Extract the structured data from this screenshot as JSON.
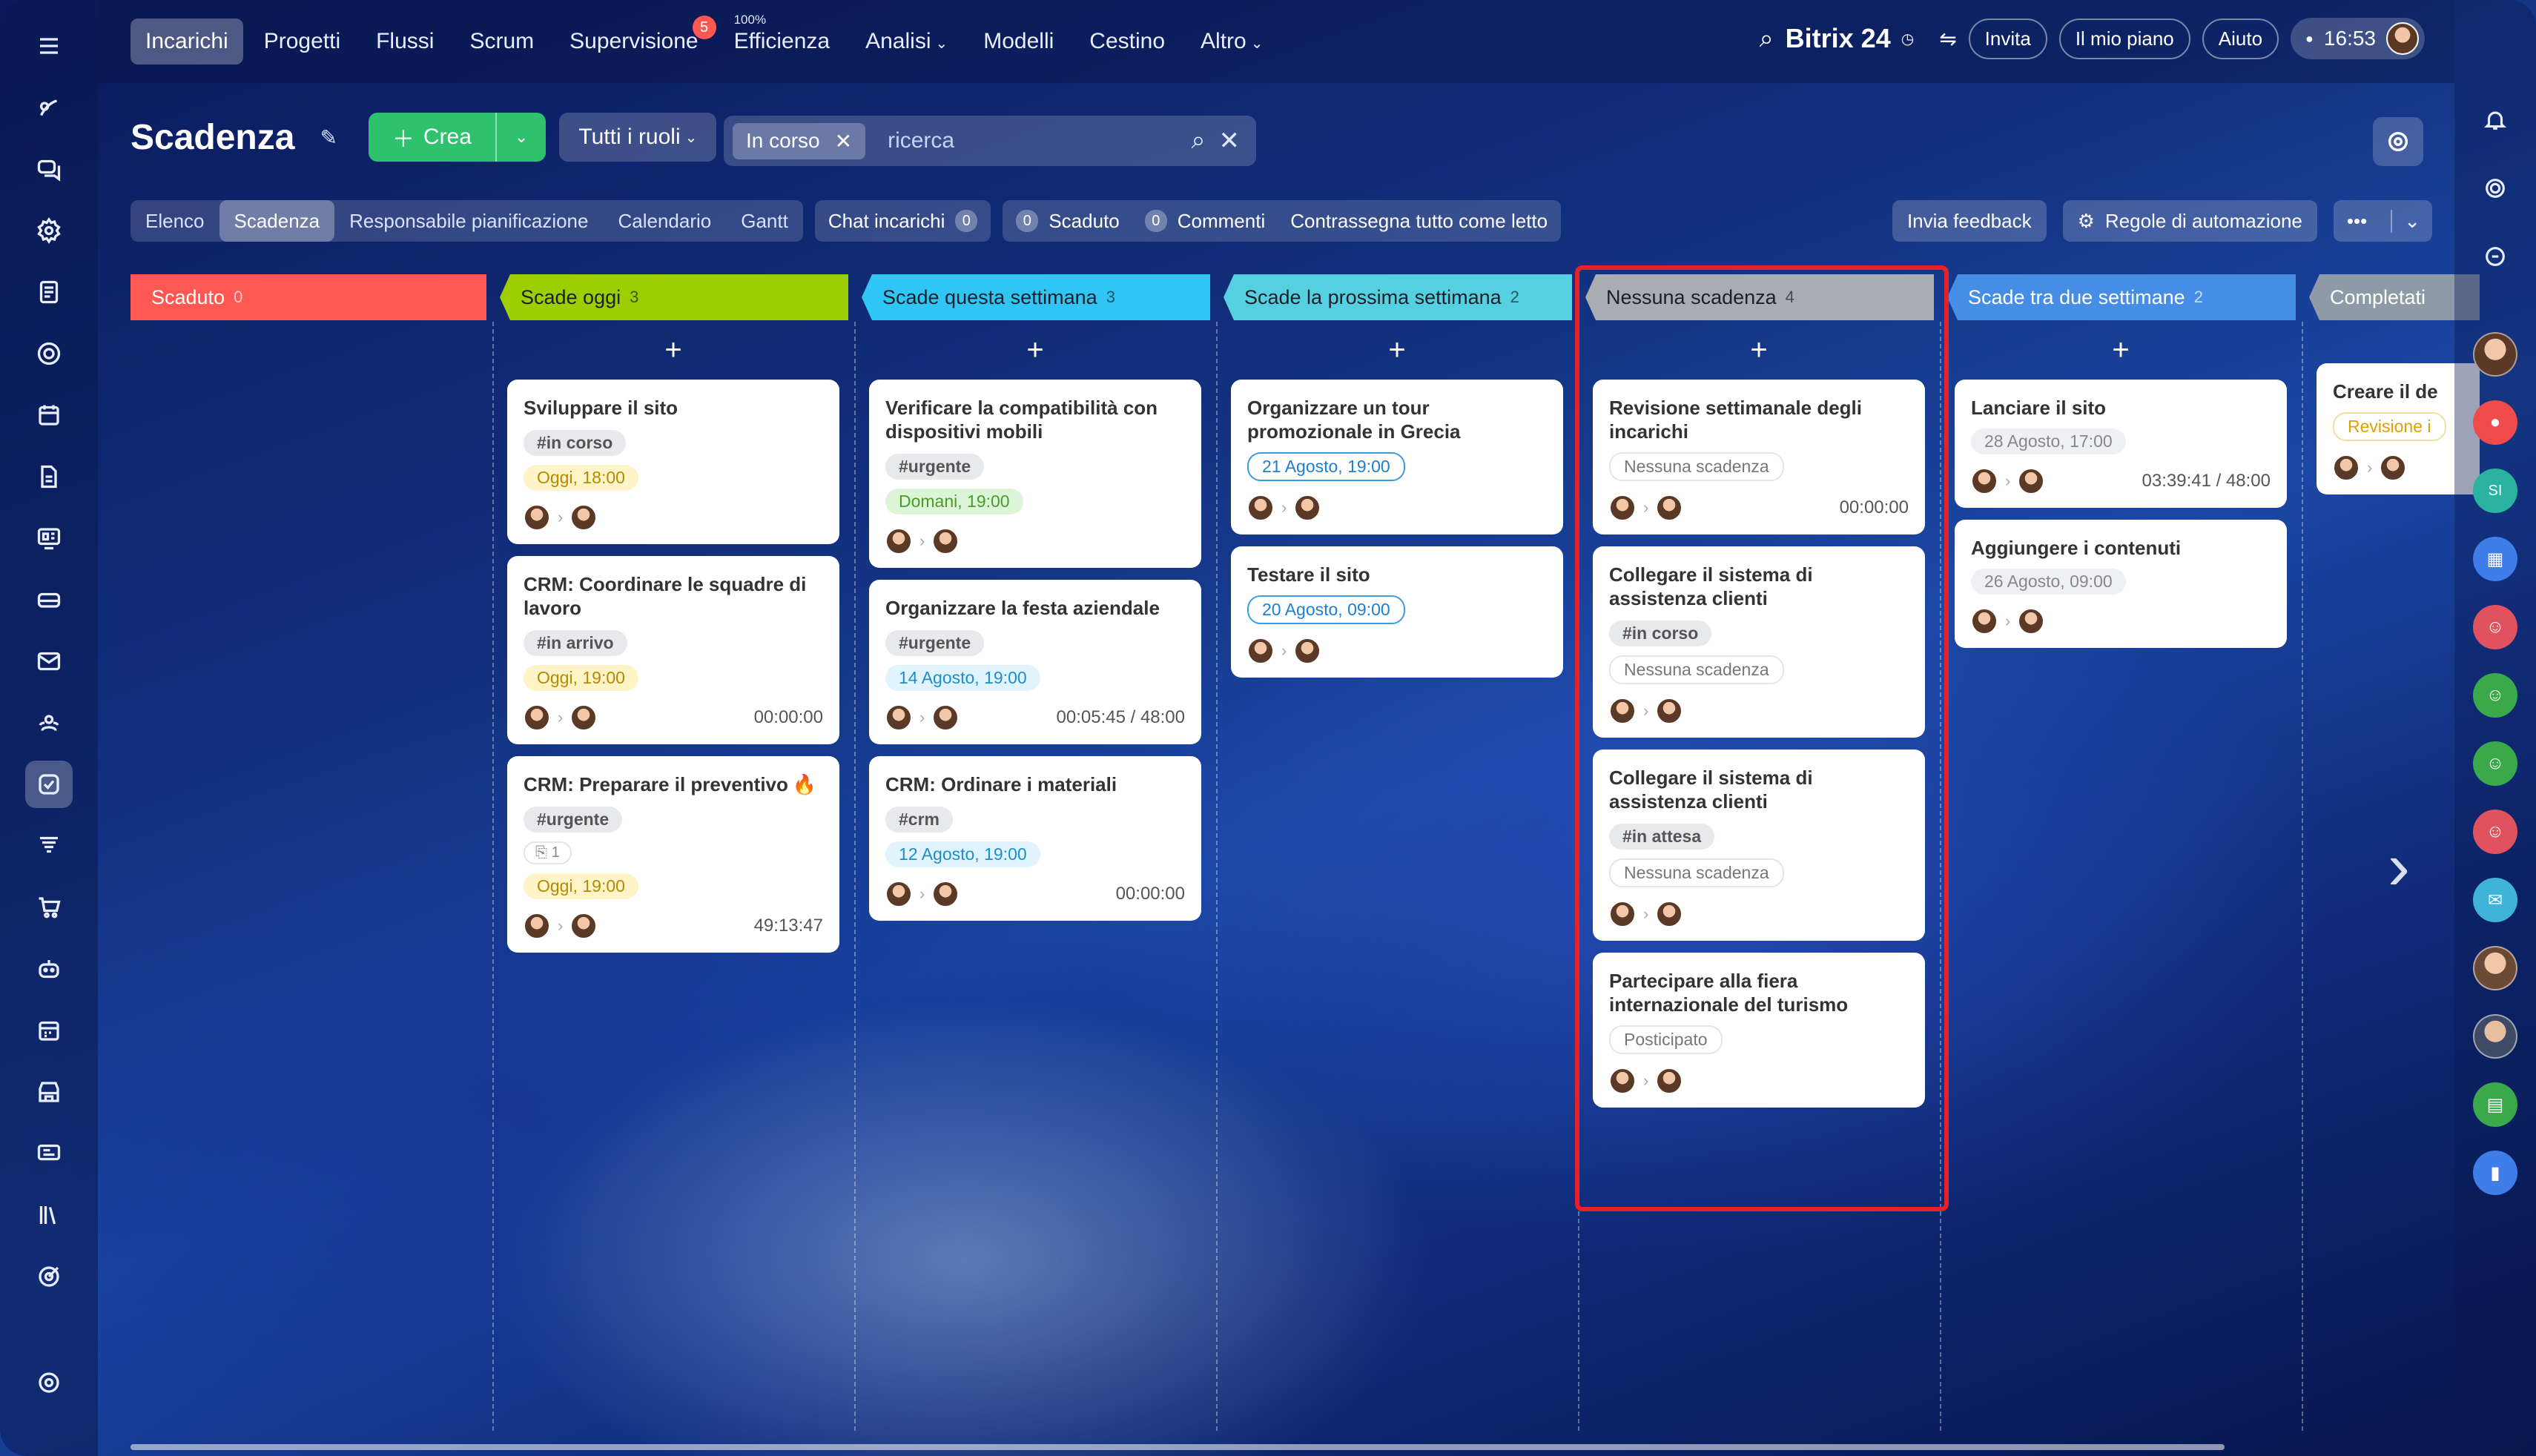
{
  "topnav": {
    "items": [
      {
        "label": "Incarichi"
      },
      {
        "label": "Progetti"
      },
      {
        "label": "Flussi"
      },
      {
        "label": "Scrum"
      },
      {
        "label": "Supervisione",
        "badge": "5"
      },
      {
        "label": "Efficienza",
        "super": "100%"
      },
      {
        "label": "Analisi"
      },
      {
        "label": "Modelli"
      },
      {
        "label": "Cestino"
      },
      {
        "label": "Altro"
      }
    ],
    "brand": "Bitrix 24",
    "invite": "Invita",
    "plan": "Il mio piano",
    "help": "Aiuto",
    "time": "16:53"
  },
  "header": {
    "title": "Scadenza",
    "create": "Crea",
    "roles": "Tutti i ruoli",
    "filter_chip": "In corso",
    "search_placeholder": "ricerca"
  },
  "toolbar": {
    "views": [
      "Elenco",
      "Scadenza",
      "Responsabile pianificazione",
      "Calendario",
      "Gantt"
    ],
    "chat": "Chat incarichi",
    "chat_count": "0",
    "overdue_count": "0",
    "overdue": "Scaduto",
    "comments_count": "0",
    "comments": "Commenti",
    "mark_read": "Contrassegna tutto come letto",
    "feedback": "Invia feedback",
    "automation": "Regole di automazione",
    "more": "•••"
  },
  "columns": [
    {
      "title": "Scaduto",
      "count": "0",
      "color": "#ff5752",
      "cards": []
    },
    {
      "title": "Scade oggi",
      "count": "3",
      "color": "#9dcf00",
      "cards": [
        {
          "title": "Sviluppare il sito",
          "tag": "#in corso",
          "due": "Oggi, 18:00",
          "due_type": "today",
          "timer": ""
        },
        {
          "title": "CRM: Coordinare le squadre di lavoro",
          "tag": "#in arrivo",
          "due": "Oggi, 19:00",
          "due_type": "today",
          "timer": "00:00:00"
        },
        {
          "title": "CRM: Preparare il preventivo",
          "tag": "#urgente",
          "subtask": "1",
          "due": "Oggi, 19:00",
          "due_type": "today",
          "timer": "49:13:47",
          "fire": true
        }
      ]
    },
    {
      "title": "Scade questa settimana",
      "count": "3",
      "color": "#2fc6f6",
      "cards": [
        {
          "title": "Verificare la compatibilità con dispositivi mobili",
          "tag": "#urgente",
          "due": "Domani, 19:00",
          "due_type": "tomorrow",
          "timer": ""
        },
        {
          "title": "Organizzare la festa aziendale",
          "tag": "#urgente",
          "due": "14 Agosto, 19:00",
          "due_type": "week",
          "timer": "00:05:45 / 48:00"
        },
        {
          "title": "CRM: Ordinare i materiali",
          "tag": "#crm",
          "due": "12 Agosto, 19:00",
          "due_type": "week",
          "timer": "00:00:00"
        }
      ]
    },
    {
      "title": "Scade la prossima settimana",
      "count": "2",
      "color": "#55d0e0",
      "cards": [
        {
          "title": "Organizzare un tour promozionale in Grecia",
          "tag": "",
          "due": "21 Agosto, 19:00",
          "due_type": "nextweek",
          "timer": ""
        },
        {
          "title": "Testare il sito",
          "tag": "",
          "due": "20 Agosto, 09:00",
          "due_type": "nextweek",
          "timer": ""
        }
      ]
    },
    {
      "title": "Nessuna scadenza",
      "count": "4",
      "color": "#a8adb4",
      "cards": [
        {
          "title": "Revisione settimanale degli incarichi",
          "tag": "",
          "due": "Nessuna scadenza",
          "due_type": "none",
          "timer": "00:00:00"
        },
        {
          "title": "Collegare il sistema di assistenza clienti",
          "tag": "#in corso",
          "due": "Nessuna scadenza",
          "due_type": "none",
          "timer": ""
        },
        {
          "title": "Collegare il sistema di assistenza clienti",
          "tag": "#in attesa",
          "due": "Nessuna scadenza",
          "due_type": "none",
          "timer": ""
        },
        {
          "title": "Partecipare alla fiera internazionale del turismo",
          "tag": "",
          "due": "Posticipato",
          "due_type": "none",
          "timer": ""
        }
      ]
    },
    {
      "title": "Scade tra due settimane",
      "count": "2",
      "color": "#468ee5",
      "cards": [
        {
          "title": "Lanciare il sito",
          "tag": "",
          "due": "28 Agosto, 17:00",
          "due_type": "past",
          "timer": "03:39:41 / 48:00"
        },
        {
          "title": "Aggiungere i contenuti",
          "tag": "",
          "due": "26 Agosto, 09:00",
          "due_type": "past",
          "timer": ""
        }
      ]
    },
    {
      "title": "Completati",
      "count": "",
      "color": "#8f9aa8",
      "cards": [
        {
          "title": "Creare il de",
          "tag": "",
          "due": "Revisione i",
          "due_type": "review",
          "timer": ""
        }
      ]
    }
  ]
}
